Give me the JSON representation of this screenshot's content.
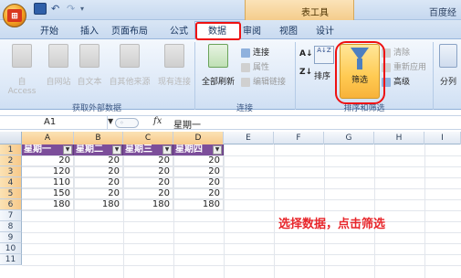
{
  "title_bar": {
    "tools_label": "表工具",
    "window_title": "百度经"
  },
  "quick_access": {
    "logo_text": "⊞"
  },
  "tabs": [
    "开始",
    "插入",
    "页面布局",
    "公式",
    "数据",
    "审阅",
    "视图",
    "设计"
  ],
  "ribbon": {
    "get_external": {
      "label": "获取外部数据",
      "buttons": [
        "自 Access",
        "自网站",
        "自文本",
        "自其他来源",
        "现有连接"
      ]
    },
    "connections": {
      "label": "连接",
      "refresh_all": "全部刷新",
      "items": [
        "连接",
        "属性",
        "编辑链接"
      ]
    },
    "sort_filter": {
      "label": "排序和筛选",
      "sort_asc": "A↓Z",
      "sort": "排序",
      "filter": "筛选",
      "items": [
        "清除",
        "重新应用",
        "高级"
      ]
    },
    "data_tools": {
      "first": "分列"
    }
  },
  "formula_bar": {
    "name_box": "A1",
    "fx": "fx",
    "value": "星期一"
  },
  "columns": [
    "A",
    "B",
    "C",
    "D",
    "E",
    "F",
    "G",
    "H",
    "I"
  ],
  "rows": [
    "1",
    "2",
    "3",
    "4",
    "5",
    "6",
    "7",
    "8",
    "9",
    "10",
    "11"
  ],
  "table": {
    "headers": [
      "星期一",
      "星期二",
      "星期三",
      "星期四"
    ],
    "values": [
      [
        "20",
        "20",
        "20",
        "20"
      ],
      [
        "120",
        "20",
        "20",
        "20"
      ],
      [
        "110",
        "20",
        "20",
        "20"
      ],
      [
        "150",
        "20",
        "20",
        "20"
      ],
      [
        "180",
        "180",
        "180",
        "180"
      ]
    ]
  },
  "annotation": "选择数据，点击筛选",
  "colors": {
    "header_fill": "#7c4e9a",
    "highlight": "#e11111",
    "annotation": "#e8262b"
  }
}
